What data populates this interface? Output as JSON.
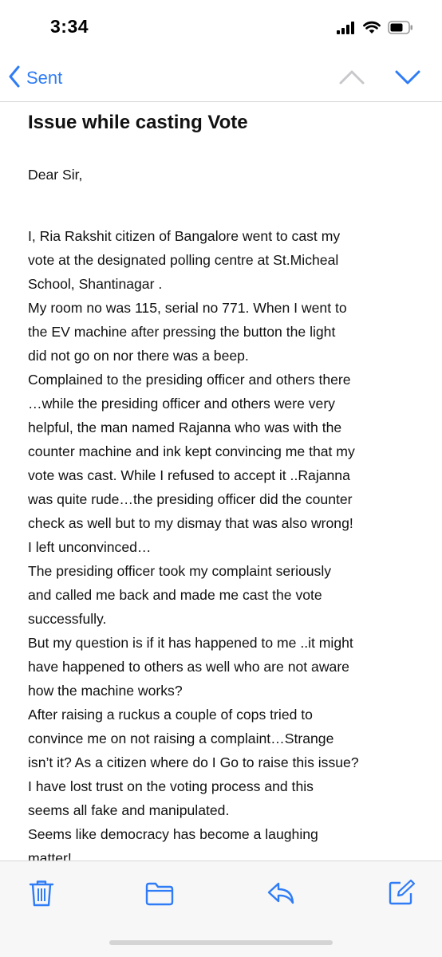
{
  "status_bar": {
    "time": "3:34",
    "icons": [
      "cellular-signal-icon",
      "wifi-icon",
      "battery-icon"
    ]
  },
  "nav": {
    "back_label": "Sent",
    "icons": [
      "chevron-left-icon",
      "chevron-up-icon",
      "chevron-down-icon"
    ],
    "accent_color": "#2f7cf6"
  },
  "email": {
    "subject": "Issue while casting Vote",
    "greeting": "Dear Sir,",
    "body_lines": [
      "I, Ria Rakshit citizen of Bangalore went to cast my",
      "vote at the designated polling centre at St.Micheal",
      "School, Shantinagar .",
      "My room no was 115, serial no 771. When I went to",
      "the EV machine after pressing the button the light",
      "did not go on nor there was a beep.",
      "Complained to the presiding officer and others there",
      "…while the presiding officer and others were very",
      "helpful, the man named Rajanna who was with the",
      "counter machine and ink kept convincing me that my",
      "vote was cast. While I refused to accept it ..Rajanna",
      "was quite rude…the presiding officer did the counter",
      "check as well but to my dismay that was also wrong!",
      "I left unconvinced…",
      "The presiding officer took my complaint seriously",
      "and called me back and made me cast the vote",
      "successfully.",
      "But my question is if it has happened to me ..it might",
      "have happened to others as well who are not aware",
      "how the machine works?",
      "After raising a ruckus a couple of cops tried to",
      "convince me on not raising a complaint…Strange",
      "isn’t it? As a citizen where do I Go to raise this issue?",
      "I have lost trust on the voting process and this",
      "seems all fake and manipulated.",
      "Seems like democracy has become a laughing",
      "matter!"
    ]
  },
  "toolbar": {
    "icons": [
      "trash-icon",
      "folder-icon",
      "reply-icon",
      "compose-icon"
    ]
  }
}
